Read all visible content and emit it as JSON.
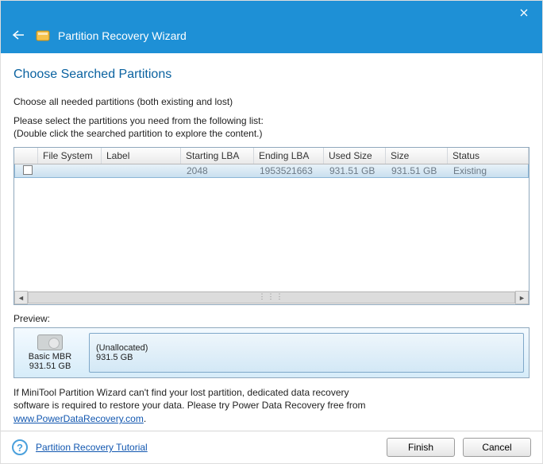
{
  "window": {
    "title": "Partition Recovery Wizard"
  },
  "page": {
    "heading": "Choose Searched Partitions",
    "subtext": "Choose all needed partitions (both existing and lost)",
    "instruction1": "Please select the partitions you need from the following list:",
    "instruction2": "(Double click the searched partition to explore the content.)"
  },
  "table": {
    "columns": [
      "",
      "File System",
      "Label",
      "Starting LBA",
      "Ending LBA",
      "Used Size",
      "Size",
      "Status"
    ],
    "rows": [
      {
        "checked": false,
        "file_system": "",
        "label": "",
        "starting_lba": "2048",
        "ending_lba": "1953521663",
        "used_size": "931.51 GB",
        "size": "931.51 GB",
        "status": "Existing"
      }
    ]
  },
  "preview": {
    "label": "Preview:",
    "disk": {
      "type": "Basic MBR",
      "size": "931.51 GB"
    },
    "partition": {
      "name": "(Unallocated)",
      "size": "931.5 GB"
    }
  },
  "note": {
    "line1": "If MiniTool Partition Wizard can't find your lost partition, dedicated data recovery",
    "line2": "software is required to restore your data. Please try Power Data Recovery free from",
    "link": "www.PowerDataRecovery.com"
  },
  "footer": {
    "tutorial_link": "Partition Recovery Tutorial",
    "finish": "Finish",
    "cancel": "Cancel"
  }
}
